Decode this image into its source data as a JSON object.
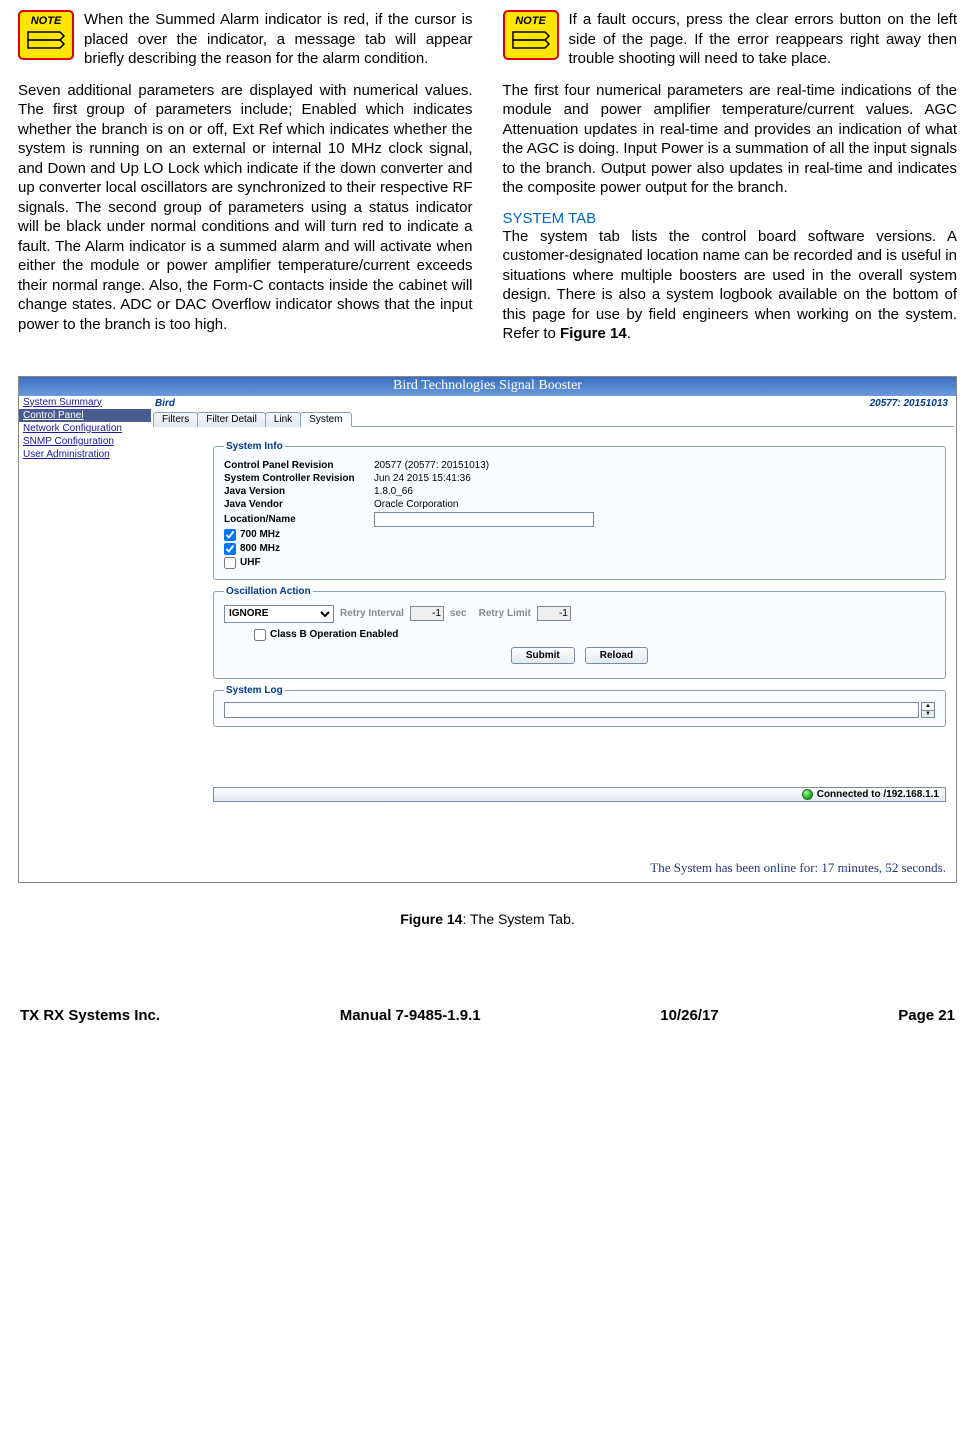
{
  "notes": {
    "label": "NOTE",
    "left": "When the Summed Alarm indicator is red, if the cursor is placed over the indicator, a message tab will appear briefly describing the reason for the alarm condition.",
    "right": "If a fault occurs, press the clear errors button on the left side of the page. If the error reappears right away then trouble shooting will need to take place."
  },
  "paragraphs": {
    "left_main": "Seven additional parameters are displayed with numerical values. The first group of parameters include; Enabled which indicates whether the branch is on or off, Ext Ref which indicates whether the system is running on an external or internal 10 MHz clock signal, and Down and Up LO Lock which indicate if the down converter and up converter local oscillators are synchronized to their respective RF signals. The second group of parameters using a status indicator will be black under normal conditions and will turn red to indicate a fault. The Alarm indicator is a summed alarm and will activate when either the module or power amplifier temperature/current exceeds their normal range. Also, the Form-C contacts inside the cabinet will change states. ADC or DAC Overflow indicator shows that the input power to the branch is too high.",
    "right_top": "The first four numerical parameters are real-time indications of the module and power amplifier temperature/current values. AGC Attenuation updates in real-time and provides an indication of what the AGC is doing. Input Power is a summation of all the input signals to the branch. Output power also updates in real-time and indicates the composite power output for the branch.",
    "system_tab_head": "SYSTEM TAB",
    "system_tab_body": "The system tab lists the control board software versions. A customer-designated location name can be recorded and is useful in situations where multiple boosters are used in the overall system design. There is also a system logbook available on the bottom of this page for use by field engineers when working on the system. Refer to ",
    "system_tab_ref": "Figure 14"
  },
  "figure": {
    "app_title": "Bird Technologies Signal Booster",
    "sidebar": [
      "System Summary",
      "Control Panel",
      "Network Configuration",
      "SNMP Configuration",
      "User Administration"
    ],
    "sidebar_selected_index": 1,
    "brand": "Bird",
    "version_tag": "20577: 20151013",
    "tabs": [
      "Filters",
      "Filter Detail",
      "Link",
      "System"
    ],
    "active_tab_index": 3,
    "system_info": {
      "legend": "System Info",
      "rows": [
        {
          "k": "Control Panel Revision",
          "v": "20577 (20577: 20151013)"
        },
        {
          "k": "System Controller  Revision",
          "v": "Jun 24 2015 15:41:36"
        },
        {
          "k": "Java Version",
          "v": "1.8.0_66"
        },
        {
          "k": "Java Vendor",
          "v": "Oracle Corporation"
        }
      ],
      "location_label": "Location/Name",
      "location_value": "",
      "checks": [
        {
          "label": "700 MHz",
          "checked": true
        },
        {
          "label": "800 MHz",
          "checked": true
        },
        {
          "label": "UHF",
          "checked": false
        }
      ]
    },
    "oscillation": {
      "legend": "Oscillation Action",
      "mode": "IGNORE",
      "retry_interval_label": "Retry Interval",
      "retry_interval_value": "-1",
      "retry_interval_unit": "sec",
      "retry_limit_label": "Retry Limit",
      "retry_limit_value": "-1",
      "class_b_label": "Class B Operation Enabled",
      "class_b_checked": false
    },
    "buttons": {
      "submit": "Submit",
      "reload": "Reload"
    },
    "syslog_legend": "System Log",
    "status_text": "Connected to /192.168.1.1",
    "uptime": "The System has been online for: 17 minutes, 52 seconds."
  },
  "caption": {
    "label": "Figure 14",
    "text": ": The System Tab."
  },
  "footer": {
    "company": "TX RX Systems Inc.",
    "manual": "Manual 7-9485-1.9.1",
    "date": "10/26/17",
    "page": "Page 21"
  }
}
